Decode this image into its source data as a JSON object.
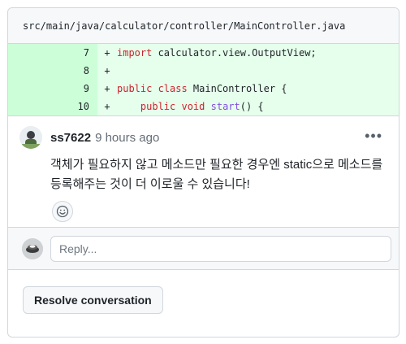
{
  "file": {
    "path": "src/main/java/calculator/controller/MainController.java"
  },
  "diff": {
    "lines": [
      {
        "number": "7",
        "sign": "+",
        "parts": [
          [
            "kw",
            "import"
          ],
          [
            "plain",
            " calculator.view.OutputView;"
          ]
        ]
      },
      {
        "number": "8",
        "sign": "+",
        "parts": []
      },
      {
        "number": "9",
        "sign": "+",
        "parts": [
          [
            "kw",
            "public class"
          ],
          [
            "plain",
            " MainController {"
          ]
        ]
      },
      {
        "number": "10",
        "sign": "+",
        "parts": [
          [
            "plain",
            "    "
          ],
          [
            "kw",
            "public void"
          ],
          [
            "plain",
            " "
          ],
          [
            "fn",
            "start"
          ],
          [
            "plain",
            "() {"
          ]
        ]
      }
    ]
  },
  "comment": {
    "author": "ss7622",
    "time": "9 hours ago",
    "body": "객체가 필요하지 않고 메소드만 필요한 경우엔 static으로 메소드를 등록해주는 것이 더 이로울 수 있습니다!",
    "more_icon": "kebab-horizontal-icon",
    "reaction_icon": "smiley-icon"
  },
  "reply": {
    "placeholder": "Reply..."
  },
  "resolve": {
    "label": "Resolve conversation"
  },
  "colors": {
    "added_line_bg": "#e6ffec",
    "added_number_bg": "#ccffd8",
    "keyword": "#cf222e",
    "function": "#8250df"
  }
}
